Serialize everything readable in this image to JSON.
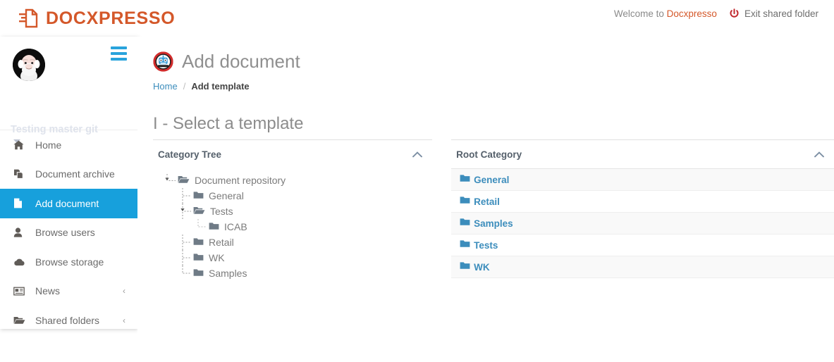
{
  "topbar": {
    "brand": "DOCXPRESSO",
    "brand_icon": "document-export-icon",
    "brand_color": "#d4582a",
    "welcome_prefix": "Welcome to ",
    "welcome_name": "Docxpresso",
    "exit_label": "Exit shared folder",
    "exit_icon": "power-icon"
  },
  "sidebar": {
    "user": {
      "name": "Testing master git",
      "avatar_icon": "user-avatar"
    },
    "toggle_icon": "hamburger-icon",
    "items": [
      {
        "label": "Home",
        "icon": "home-icon",
        "active": false,
        "arrow": ""
      },
      {
        "label": "Document archive",
        "icon": "copy-files-icon",
        "active": false,
        "arrow": ""
      },
      {
        "label": "Add document",
        "icon": "file-icon",
        "active": true,
        "arrow": ""
      },
      {
        "label": "Browse users",
        "icon": "user-icon",
        "active": false,
        "arrow": ""
      },
      {
        "label": "Browse storage",
        "icon": "cloud-icon",
        "active": false,
        "arrow": ""
      },
      {
        "label": "News",
        "icon": "newspaper-icon",
        "active": false,
        "arrow": "‹"
      },
      {
        "label": "Shared folders",
        "icon": "open-folder-icon",
        "active": false,
        "arrow": "‹"
      }
    ],
    "active_color": "#17a0dc"
  },
  "main": {
    "page_icon": "robot-badge-logo",
    "page_title": "Add document",
    "breadcrumb": {
      "home": "Home",
      "separator": "/",
      "current": "Add template"
    },
    "section_title": "I - Select a template",
    "left_panel": {
      "title": "Category Tree",
      "collapse_icon": "chevron-up-icon",
      "tree": [
        {
          "label": "Document repository",
          "depth": 0,
          "type": "open-folder",
          "last": false
        },
        {
          "label": "General",
          "depth": 1,
          "type": "folder",
          "last": false
        },
        {
          "label": "Tests",
          "depth": 1,
          "type": "open-folder",
          "last": false
        },
        {
          "label": "ICAB",
          "depth": 2,
          "type": "folder",
          "last": true
        },
        {
          "label": "Retail",
          "depth": 1,
          "type": "folder",
          "last": false
        },
        {
          "label": "WK",
          "depth": 1,
          "type": "folder",
          "last": false
        },
        {
          "label": "Samples",
          "depth": 1,
          "type": "folder",
          "last": true
        }
      ]
    },
    "right_panel": {
      "title": "Root Category",
      "collapse_icon": "chevron-up-icon",
      "categories": [
        {
          "label": "General"
        },
        {
          "label": "Retail"
        },
        {
          "label": "Samples"
        },
        {
          "label": "Tests"
        },
        {
          "label": "WK"
        }
      ],
      "link_color": "#3c8dbc"
    }
  }
}
